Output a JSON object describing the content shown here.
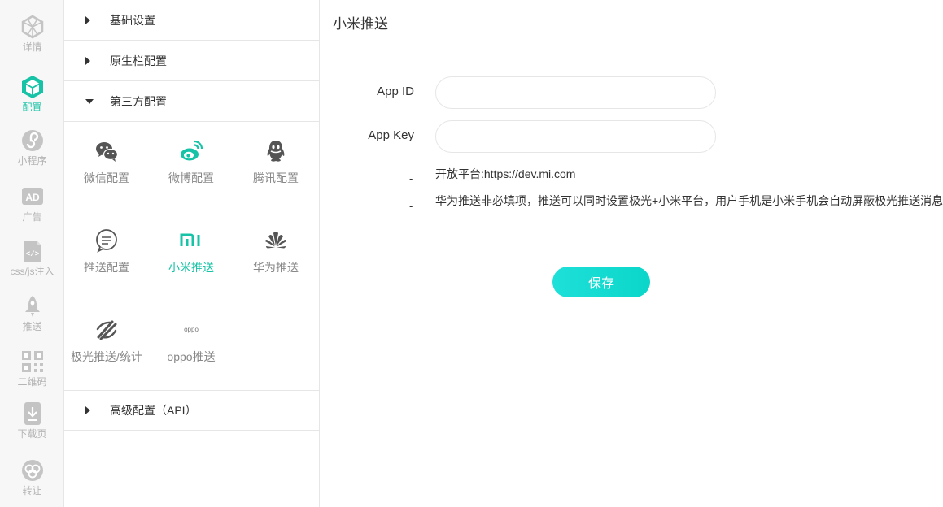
{
  "rail": {
    "items": [
      {
        "label": "详情",
        "icon": "cube-outline-icon"
      },
      {
        "label": "配置",
        "icon": "cube-solid-icon",
        "active": true
      },
      {
        "label": "小程序",
        "icon": "miniprogram-icon"
      },
      {
        "label": "广告",
        "icon": "ad-icon"
      },
      {
        "label": "css/js注入",
        "icon": "code-file-icon"
      },
      {
        "label": "推送",
        "icon": "rocket-icon"
      },
      {
        "label": "二维码",
        "icon": "qrcode-icon"
      },
      {
        "label": "下载页",
        "icon": "download-icon"
      },
      {
        "label": "转让",
        "icon": "transfer-icon"
      }
    ],
    "active_color": "#16c3a6",
    "inactive_color": "#c4c4c4"
  },
  "panel": {
    "sections": {
      "basic": "基础设置",
      "native": "原生栏配置",
      "third": "第三方配置",
      "advanced": "高级配置（API）"
    },
    "third_items": [
      {
        "label": "微信配置",
        "icon": "wechat-icon"
      },
      {
        "label": "微博配置",
        "icon": "weibo-icon"
      },
      {
        "label": "腾讯配置",
        "icon": "qq-icon"
      },
      {
        "label": "推送配置",
        "icon": "chat-bubble-icon"
      },
      {
        "label": "小米推送",
        "icon": "xiaomi-icon",
        "active": true
      },
      {
        "label": "华为推送",
        "icon": "huawei-icon"
      },
      {
        "label": "极光推送/统计",
        "icon": "jpush-icon"
      },
      {
        "label": "oppo推送",
        "icon": "oppo-icon",
        "logo_text": "oppo"
      }
    ]
  },
  "main": {
    "title": "小米推送",
    "fields": {
      "app_id_label": "App ID",
      "app_id_value": "",
      "app_key_label": "App Key",
      "app_key_value": ""
    },
    "dash1": "-",
    "dash2": "-",
    "note1": "开放平台:https://dev.mi.com",
    "note2": "华为推送非必填项，推送可以同时设置极光+小米平台，用户手机是小米手机会自动屏蔽极光推送消息",
    "save_label": "保存",
    "accent": "#16c3a6",
    "button_color": "#13dbcf"
  }
}
